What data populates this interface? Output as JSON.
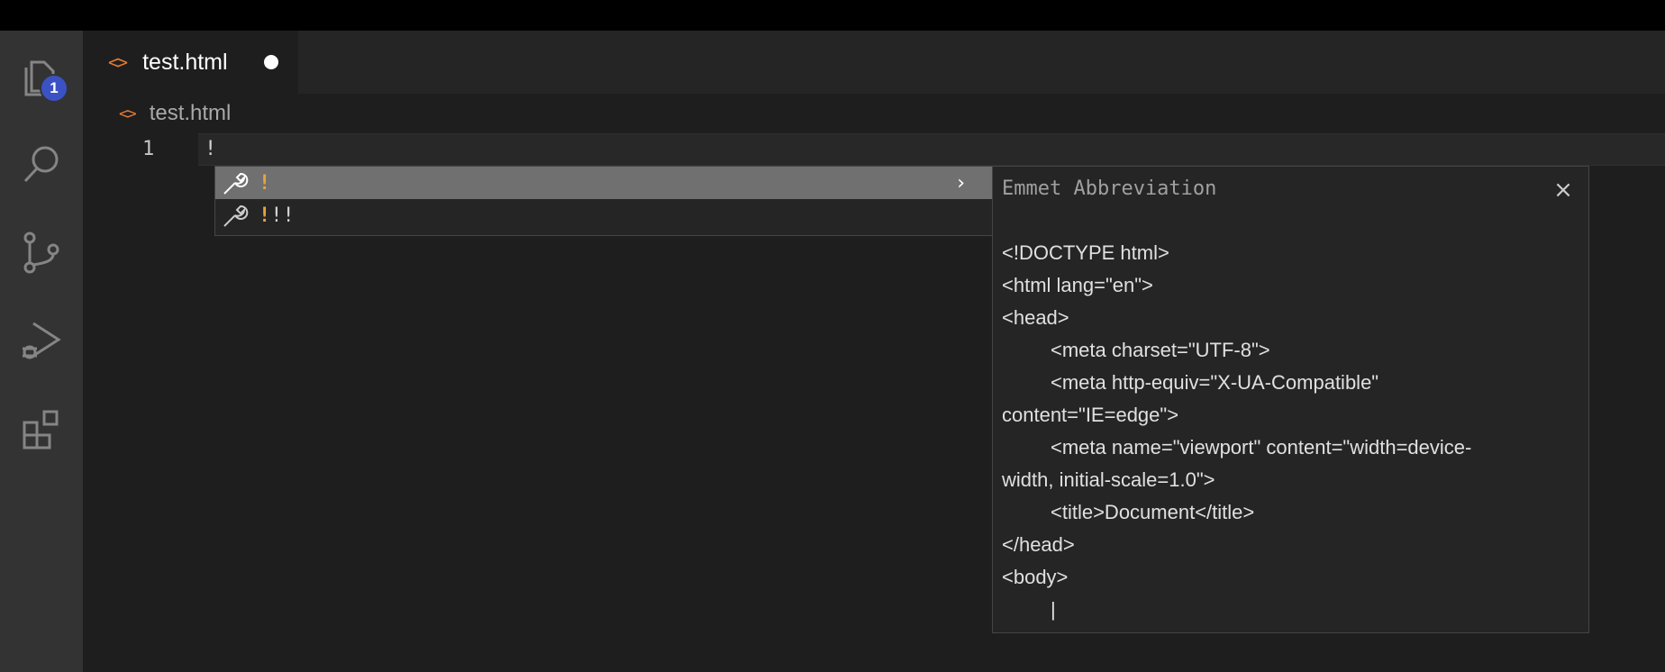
{
  "activity_bar": {
    "explorer_badge": "1",
    "icons": [
      "files-icon",
      "search-icon",
      "source-control-icon",
      "run-debug-icon",
      "extensions-icon"
    ]
  },
  "tab": {
    "filename": "test.html",
    "icon": "<>"
  },
  "breadcrumb": {
    "filename": "test.html",
    "icon": "<>"
  },
  "editor": {
    "line_number": "1",
    "line_text": "!"
  },
  "suggestions": [
    {
      "highlight": "!",
      "rest": "",
      "selected": true
    },
    {
      "highlight": "!",
      "rest": "!!",
      "selected": false
    }
  ],
  "details": {
    "title": "Emmet Abbreviation",
    "close_icon": "×",
    "lines": [
      {
        "text": "<!DOCTYPE html>",
        "indent": false
      },
      {
        "text": "<html lang=\"en\">",
        "indent": false
      },
      {
        "text": "<head>",
        "indent": false
      },
      {
        "text": "<meta charset=\"UTF-8\">",
        "indent": true
      },
      {
        "text": "<meta http-equiv=\"X-UA-Compatible\"",
        "indent": true
      },
      {
        "text": "content=\"IE=edge\">",
        "indent": false
      },
      {
        "text": "<meta name=\"viewport\" content=\"width=device-",
        "indent": true
      },
      {
        "text": "width, initial-scale=1.0\">",
        "indent": false
      },
      {
        "text": "<title>Document</title>",
        "indent": true
      },
      {
        "text": "</head>",
        "indent": false
      },
      {
        "text": "<body>",
        "indent": false
      },
      {
        "text": "|",
        "indent": true
      }
    ]
  },
  "colors": {
    "accent_orange": "#e37933",
    "badge_blue": "#3b52c4",
    "selected_row": "#707070"
  }
}
